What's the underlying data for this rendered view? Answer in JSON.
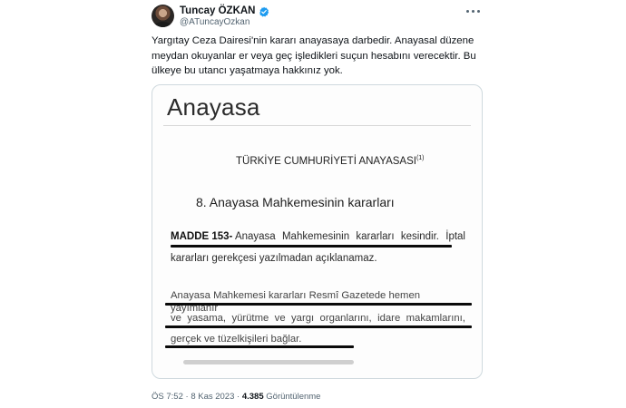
{
  "author": {
    "display_name": "Tuncay ÖZKAN",
    "handle": "@ATuncayOzkan",
    "verified_color": "#1d9bf0"
  },
  "tweet": {
    "text_lines": [
      "Yargıtay Ceza Dairesi'nin kararı anayasaya darbedir. Anayasal düzene",
      "meydan okuyanlar er veya geç işledikleri suçun hesabını verecektir. Bu",
      "ülkeye bu utancı yaşatmaya hakkınız yok."
    ]
  },
  "document": {
    "heading": "Anayasa",
    "subtitle": "TÜRKİYE CUMHURİYETİ ANAYASASI",
    "subtitle_sup": "(1)",
    "section": "8. Anayasa Mahkemesinin kararları",
    "article_label": "MADDE 153-",
    "p1_line1_words": [
      "Anayasa",
      "Mahkemesinin",
      "kararları",
      "kesindir.",
      "İptal"
    ],
    "p1_line2": "kararları gerekçesi yazılmadan açıklanamaz.",
    "p2_line1": "Anayasa Mahkemesi kararları Resmî Gazetede hemen yayımlanır",
    "p2_line2_words": [
      "ve",
      "yasama,",
      "yürütme",
      "ve",
      "yargı",
      "organlarını,",
      "idare",
      "makamlarını,"
    ],
    "p2_line3": "gerçek ve tüzelkişileri bağlar."
  },
  "meta": {
    "time": "ÖS 7:52",
    "separator": "·",
    "date": "8 Kas 2023",
    "views_count": "4.385",
    "views_label": "Görüntülenme"
  }
}
